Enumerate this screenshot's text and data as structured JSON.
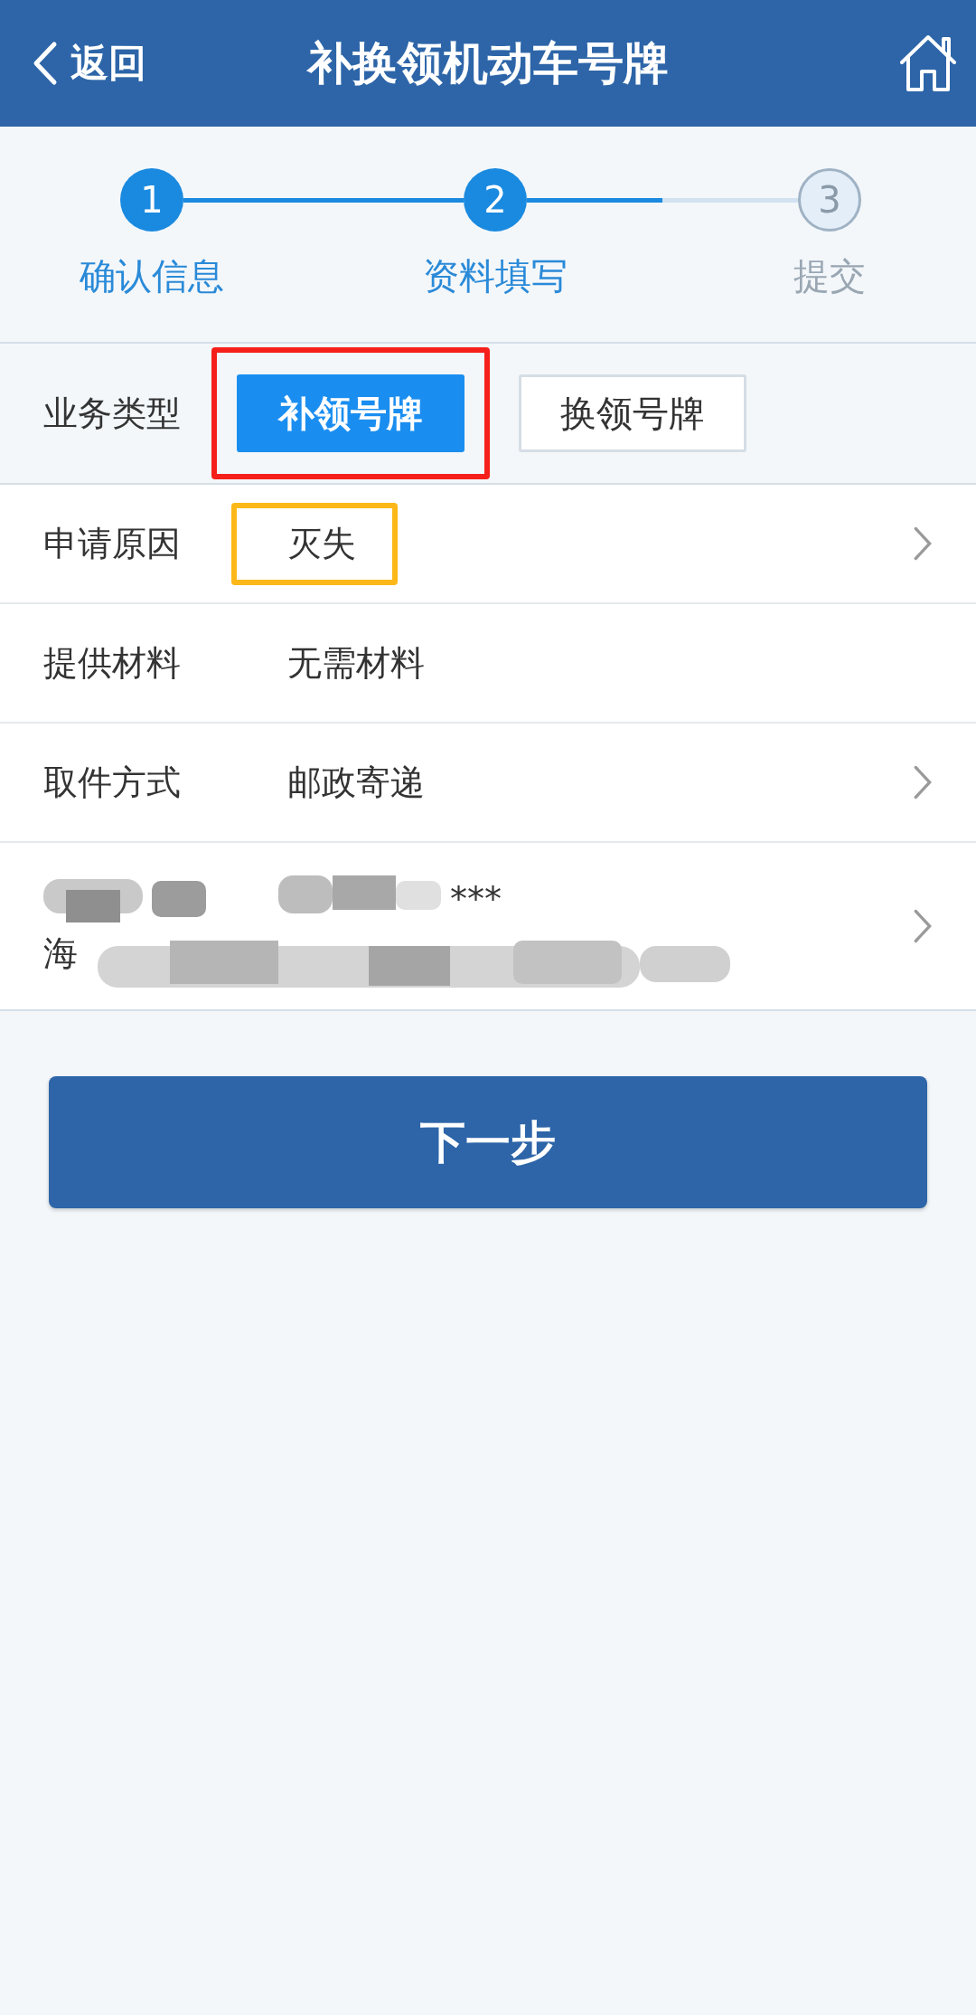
{
  "header": {
    "back_label": "返回",
    "title": "补换领机动车号牌"
  },
  "steps": {
    "connectors": [
      {
        "level": 1
      },
      {
        "level": 0.5
      }
    ],
    "items": [
      {
        "number": "1",
        "label": "确认信息",
        "kind": "done"
      },
      {
        "number": "2",
        "label": "资料填写",
        "kind": "current"
      },
      {
        "number": "3",
        "label": "提交",
        "kind": "todo"
      }
    ]
  },
  "business_type": {
    "label": "业务类型",
    "options": [
      {
        "label": "补领号牌",
        "selected": true,
        "highlighted": true
      },
      {
        "label": "换领号牌",
        "selected": false,
        "highlighted": false
      }
    ]
  },
  "rows": [
    {
      "label": "申请原因",
      "value": "灭失",
      "chevron": true,
      "highlighted": true
    },
    {
      "label": "提供材料",
      "value": "无需材料",
      "chevron": false,
      "highlighted": false
    },
    {
      "label": "取件方式",
      "value": "邮政寄递",
      "chevron": true,
      "highlighted": false
    }
  ],
  "address": {
    "phone_visible": "***",
    "address_visible": "海",
    "chevron": true
  },
  "next_button": "下一步"
}
